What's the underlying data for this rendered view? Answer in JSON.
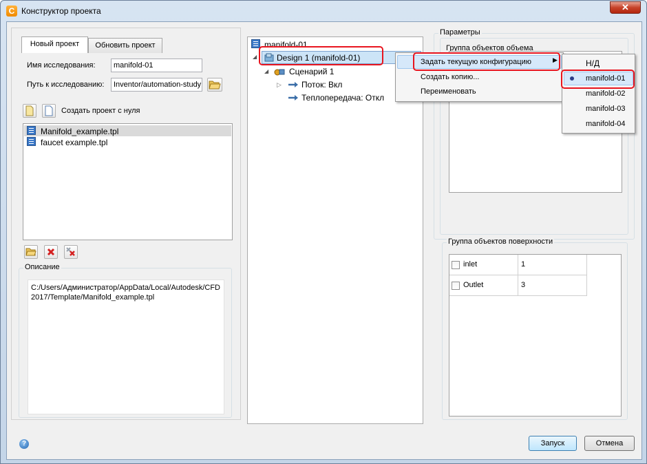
{
  "window": {
    "title": "Конструктор проекта",
    "app_icon": "C"
  },
  "left": {
    "tabs": [
      "Новый проект",
      "Обновить проект"
    ],
    "study_name_label": "Имя исследования:",
    "study_name_value": "manifold-01",
    "study_path_label": "Путь к исследованию:",
    "study_path_value": "Inventor/automation-study",
    "create_from_scratch": "Создать проект с нуля",
    "templates": [
      "Manifold_example.tpl",
      "faucet example.tpl"
    ],
    "description_legend": "Описание",
    "description_text": "C:/Users/Администратор/AppData/Local/Autodesk/CFD 2017/Template/Manifold_example.tpl"
  },
  "tree": {
    "root": "manifold-01",
    "design": "Design 1 (manifold-01)",
    "scenario": "Сценарий 1",
    "flow": "Поток: Вкл",
    "heat": "Теплопередача: Откл"
  },
  "context_menu": {
    "items": [
      "Задать текущую конфигурацию",
      "Создать копию...",
      "Переименовать"
    ],
    "submenu": [
      "Н/Д",
      "manifold-01",
      "manifold-02",
      "manifold-03",
      "manifold-04"
    ]
  },
  "params": {
    "legend": "Параметры",
    "volume_group": "Группа объектов объема",
    "surface_group": "Группа объектов поверхности",
    "surfaces": [
      {
        "name": "inlet",
        "value": "1"
      },
      {
        "name": "Outlet",
        "value": "3"
      }
    ]
  },
  "buttons": {
    "run": "Запуск",
    "cancel": "Отмена"
  },
  "colors": {
    "highlight": "#e8141e",
    "selection": "#cce4f7"
  }
}
